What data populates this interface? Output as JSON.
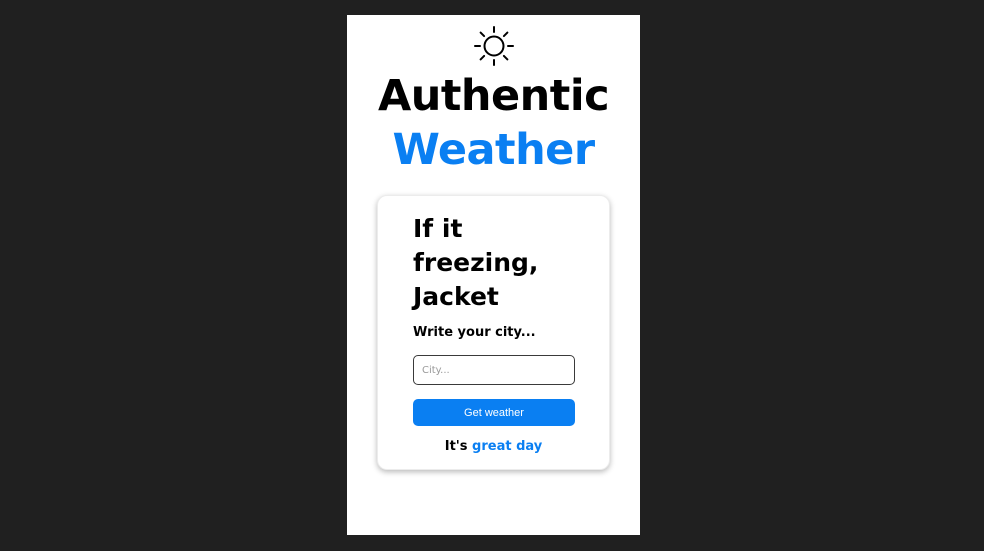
{
  "header": {
    "icon": "sun-icon",
    "title_line1": "Authentic",
    "title_line2": "Weather"
  },
  "card": {
    "heading_lines": [
      "If it",
      "freezing,",
      "Jacket"
    ],
    "prompt": "Write your city...",
    "city_input": {
      "value": "",
      "placeholder": "City..."
    },
    "button_label": "Get weather",
    "status": {
      "prefix": "It's ",
      "highlight": "great day"
    }
  },
  "colors": {
    "accent": "#0a7ff2",
    "background": "#202020",
    "surface": "#ffffff",
    "text": "#000000"
  }
}
